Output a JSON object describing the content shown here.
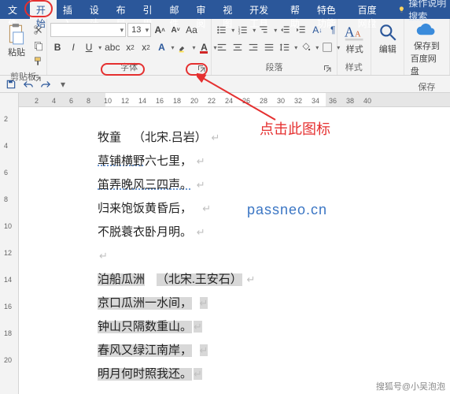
{
  "tabs": {
    "file": "文件",
    "home": "开始",
    "insert": "插入",
    "design": "设计",
    "layout": "布局",
    "references": "引用",
    "mailings": "邮件",
    "review": "审阅",
    "view": "视图",
    "devtools": "开发工具",
    "help": "帮助",
    "special": "特色功能",
    "netdisk": "百度网盘",
    "tellme": "操作说明搜索"
  },
  "ribbon": {
    "clipboard": {
      "paste": "粘贴",
      "label": "剪贴板"
    },
    "font": {
      "size_value": "13",
      "bold": "B",
      "italic": "I",
      "underline": "U",
      "label": "字体"
    },
    "paragraph": {
      "label": "段落"
    },
    "styles": {
      "label": "样式"
    },
    "editing": {
      "label": "编辑"
    },
    "save": {
      "l1": "保存到",
      "l2": "百度网盘",
      "label": "保存"
    },
    "aa": "Aa"
  },
  "ruler": {
    "left_gray_end": 110,
    "right_gray_start": 390,
    "labels": [
      "2",
      "4",
      "6",
      "8",
      "10",
      "12",
      "14",
      "16",
      "18",
      "20",
      "22",
      "24",
      "26",
      "28",
      "30",
      "32",
      "34",
      "36",
      "38",
      "40"
    ]
  },
  "vruler": [
    "2",
    "4",
    "6",
    "8",
    "10",
    "12",
    "14",
    "16",
    "18",
    "20"
  ],
  "doc": {
    "poem1": {
      "title_a": "牧童",
      "title_b": "（北宋.吕岩）",
      "l1_a": "草铺横野",
      "l1_b": "六七里，",
      "l2": "笛弄晚风三四声。",
      "l3": "归来饱饭黄昏后，",
      "l4": "不脱蓑衣卧月明。"
    },
    "poem2": {
      "title_a": "泊船瓜洲",
      "title_b": "（北宋.王安石）",
      "l1": "京口瓜洲一水间，",
      "l2": "钟山只隔数重山。",
      "l3": "春风又绿江南岸，",
      "l4": "明月何时照我还。"
    }
  },
  "callout": "点击此图标",
  "watermark": "passneo.cn",
  "credit": "搜狐号@小吴泡泡"
}
